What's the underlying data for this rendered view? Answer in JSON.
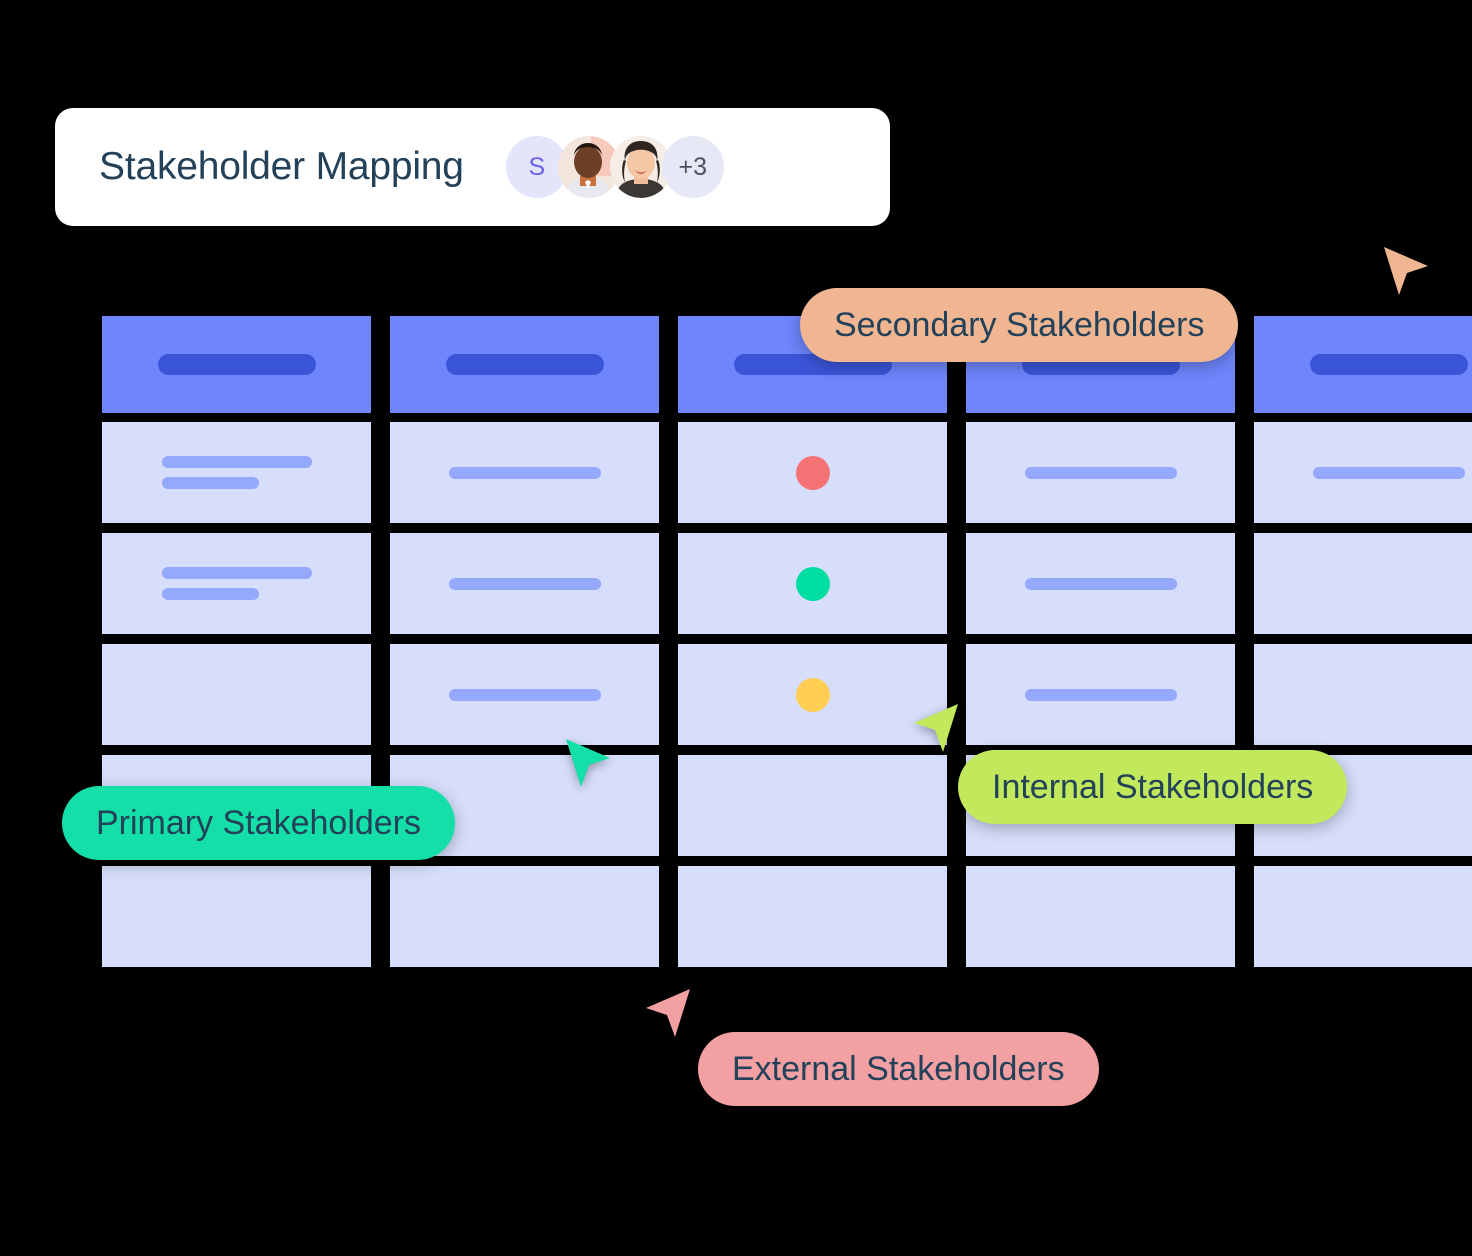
{
  "card": {
    "title": "Stakeholder Mapping",
    "avatars": [
      {
        "type": "initial",
        "label": "S",
        "name": "avatar-initial-s"
      },
      {
        "type": "photo",
        "label": "",
        "name": "avatar-photo-1"
      },
      {
        "type": "photo",
        "label": "",
        "name": "avatar-photo-2"
      },
      {
        "type": "more",
        "label": "+3",
        "name": "avatar-overflow-count"
      }
    ]
  },
  "colors": {
    "header_cell": "#6E85FB",
    "header_pill": "#3B55D9",
    "body_cell": "#D6DEFB",
    "skeleton": "#94A8FC",
    "title_text": "#234159",
    "dot_red": "#F47174",
    "dot_green": "#00DFA2",
    "dot_yellow": "#FFCE52",
    "label_secondary": "#EFB691",
    "label_internal": "#C2E95C",
    "label_primary": "#15DFA8",
    "label_external": "#F3A0A3"
  },
  "grid": {
    "columns": 5,
    "header": [
      {
        "pill": true
      },
      {
        "pill": true
      },
      {
        "pill": true
      },
      {
        "pill": true
      },
      {
        "pill": true
      }
    ],
    "rows": [
      [
        {
          "content": "two-lines"
        },
        {
          "content": "one-line"
        },
        {
          "content": "dot",
          "dot_color": "#F47174"
        },
        {
          "content": "one-line"
        },
        {
          "content": "one-line"
        }
      ],
      [
        {
          "content": "two-lines"
        },
        {
          "content": "one-line"
        },
        {
          "content": "dot",
          "dot_color": "#00DFA2"
        },
        {
          "content": "one-line"
        },
        {
          "content": "empty"
        }
      ],
      [
        {
          "content": "empty"
        },
        {
          "content": "one-line"
        },
        {
          "content": "dot",
          "dot_color": "#FFCE52"
        },
        {
          "content": "one-line"
        },
        {
          "content": "empty"
        }
      ],
      [
        {
          "content": "empty"
        },
        {
          "content": "empty"
        },
        {
          "content": "empty"
        },
        {
          "content": "empty"
        },
        {
          "content": "empty"
        }
      ],
      [
        {
          "content": "empty"
        },
        {
          "content": "empty"
        },
        {
          "content": "empty"
        },
        {
          "content": "empty"
        },
        {
          "content": "empty"
        }
      ]
    ]
  },
  "cursors": [
    {
      "id": "secondary",
      "label": "Secondary Stakeholders",
      "color": "#EFB691"
    },
    {
      "id": "internal",
      "label": "Internal Stakeholders",
      "color": "#C2E95C"
    },
    {
      "id": "primary",
      "label": "Primary Stakeholders",
      "color": "#15DFA8"
    },
    {
      "id": "external",
      "label": "External Stakeholders",
      "color": "#F3A0A3"
    }
  ]
}
